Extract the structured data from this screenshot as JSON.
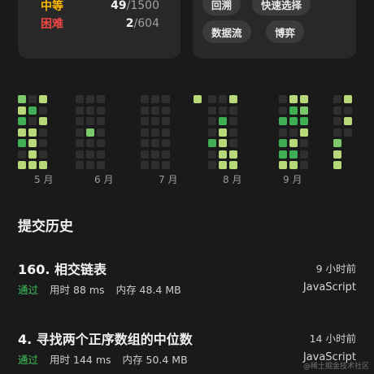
{
  "stats": {
    "medium": {
      "label": "中等",
      "solved": "49",
      "total": "/1500",
      "color": "#ffb800"
    },
    "hard": {
      "label": "困难",
      "solved": "2",
      "total": "/604",
      "color": "#ef4743"
    }
  },
  "tags": [
    "回溯",
    "快速选择",
    "数据流",
    "博弈"
  ],
  "heatmap": {
    "colors": {
      "empty": "#2f2f2f",
      "low": "#b7d97a",
      "mid": "#7cc96b",
      "high": "#3fae55"
    },
    "months": [
      "5 月",
      "6 月",
      "7 月",
      "8 月",
      "9 月"
    ]
  },
  "history": {
    "title": "提交历史",
    "items": [
      {
        "title": "160. 相交链表",
        "time": "9 小时前",
        "status": "通过",
        "runtime": "用时 88 ms",
        "memory": "内存 48.4 MB",
        "lang": "JavaScript"
      },
      {
        "title": "4. 寻找两个正序数组的中位数",
        "time": "14 小时前",
        "status": "通过",
        "runtime": "用时 144 ms",
        "memory": "内存 50.4 MB",
        "lang": "JavaScript"
      }
    ]
  },
  "watermark": "@稀土掘金技术社区"
}
